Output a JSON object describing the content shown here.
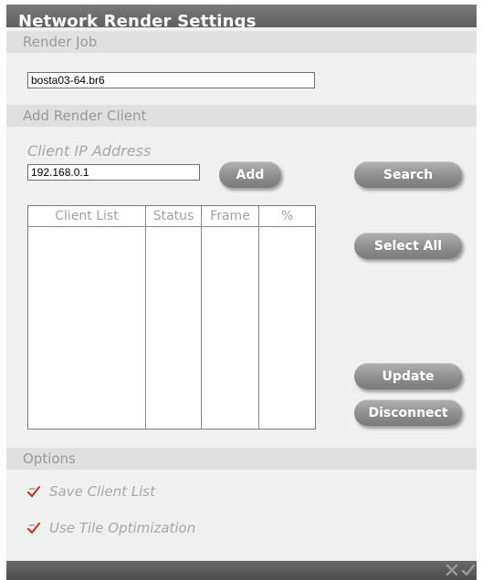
{
  "window": {
    "title": "Network Render Settings"
  },
  "sections": {
    "render_job": "Render Job",
    "add_client": "Add Render Client",
    "options": "Options"
  },
  "render_job": {
    "filename": "bosta03-64.br6"
  },
  "client": {
    "ip_label": "Client IP Address",
    "ip_value": "192.168.0.1"
  },
  "buttons": {
    "add": "Add",
    "search": "Search",
    "select_all": "Select All",
    "update": "Update",
    "disconnect": "Disconnect"
  },
  "client_table": {
    "columns": [
      "Client List",
      "Status",
      "Frame",
      "%"
    ],
    "rows": []
  },
  "options": {
    "items": [
      {
        "label": "Save Client List",
        "checked": true
      },
      {
        "label": "Use Tile Optimization",
        "checked": true
      }
    ]
  },
  "bottom_bar": {
    "icons": [
      "close-icon",
      "confirm-check-icon"
    ]
  },
  "colors": {
    "titlebar": "#666666",
    "section_bar": "#e0e0e0",
    "label_gray": "#a8a8a8",
    "check_red": "#c0392b",
    "button_gray": "#8e8e8e"
  }
}
